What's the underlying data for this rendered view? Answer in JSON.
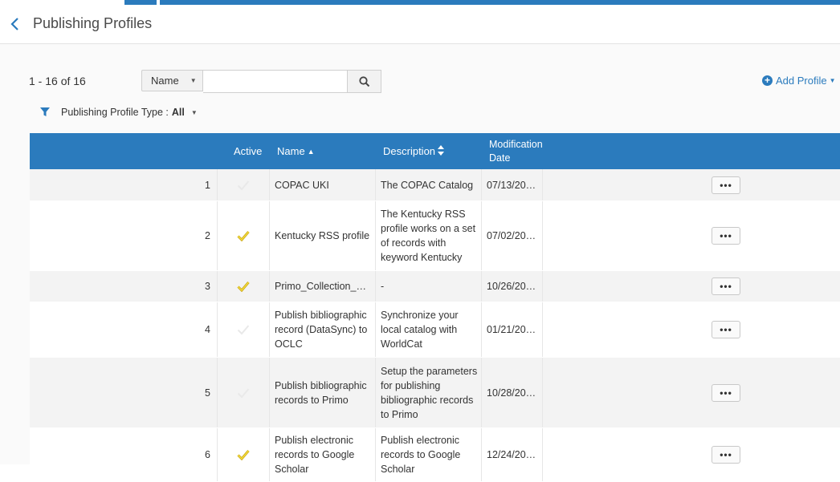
{
  "header": {
    "title": "Publishing Profiles"
  },
  "toolbar": {
    "count": "1 - 16 of 16",
    "search_type": "Name",
    "search_value": "",
    "add_label": "Add Profile"
  },
  "filter": {
    "label": "Publishing Profile Type :",
    "value": "All"
  },
  "table": {
    "columns": {
      "active": "Active",
      "name": "Name",
      "description": "Description",
      "modification": "Modification Date"
    },
    "rows": [
      {
        "num": "1",
        "active": false,
        "name": "COPAC UKI",
        "description": "The COPAC Catalog",
        "date": "07/13/20…"
      },
      {
        "num": "2",
        "active": true,
        "name": "Kentucky RSS profile",
        "description": "The Kentucky RSS profile works on a set of records with keyword Kentucky",
        "date": "07/02/20…"
      },
      {
        "num": "3",
        "active": true,
        "name": "Primo_Collection_D…",
        "description": "-",
        "date": "10/26/20…"
      },
      {
        "num": "4",
        "active": false,
        "name": "Publish bibliographic record (DataSync) to OCLC",
        "description": "Synchronize your local catalog with WorldCat",
        "date": "01/21/20…"
      },
      {
        "num": "5",
        "active": false,
        "name": "Publish bibliographic records to Primo",
        "description": "Setup the parameters for publishing bibliographic records to Primo",
        "date": "10/28/20…"
      },
      {
        "num": "6",
        "active": true,
        "name": "Publish electronic records to Google Scholar",
        "description": "Publish electronic records to Google Scholar",
        "date": "12/24/20…"
      }
    ],
    "row_action_label": "•••"
  },
  "colors": {
    "accent": "#2b7bbd",
    "check": "#e8c81e"
  }
}
